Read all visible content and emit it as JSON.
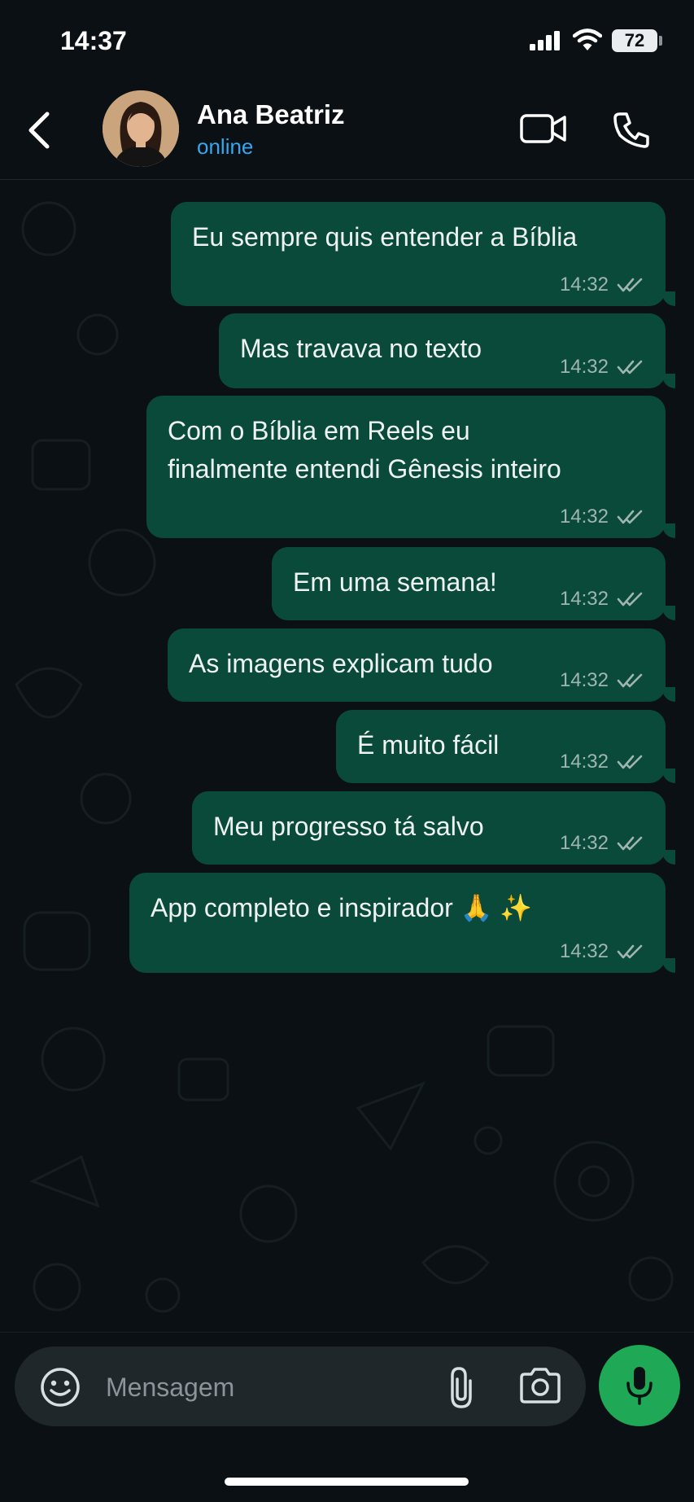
{
  "status_bar": {
    "time": "14:37",
    "battery": "72"
  },
  "header": {
    "contact_name": "Ana Beatriz",
    "contact_status": "online"
  },
  "messages": [
    {
      "text": "Eu sempre quis entender a Bíblia",
      "time": "14:32",
      "status": "read"
    },
    {
      "text": "Mas travava no texto",
      "time": "14:32",
      "status": "read"
    },
    {
      "text_lines": [
        "Com o Bíblia em Reels eu",
        "finalmente entendi Gênesis inteiro"
      ],
      "time": "14:32",
      "status": "read"
    },
    {
      "text": "Em uma semana!",
      "time": "14:32",
      "status": "read"
    },
    {
      "text": "As imagens explicam tudo",
      "time": "14:32",
      "status": "read"
    },
    {
      "text": "É muito fácil",
      "time": "14:32",
      "status": "read"
    },
    {
      "text": "Meu progresso tá salvo",
      "time": "14:32",
      "status": "read"
    },
    {
      "text": "App completo e inspirador 🙏 ✨",
      "time": "14:32",
      "status": "read"
    }
  ],
  "composer": {
    "placeholder": "Mensagem"
  },
  "colors": {
    "background": "#0b1014",
    "outgoing_bubble": "#0a4a3a",
    "online_status": "#35a7f0",
    "mic_button": "#1fa855"
  },
  "icons": [
    "back-arrow-icon",
    "video-call-icon",
    "phone-icon",
    "emoji-icon",
    "paperclip-icon",
    "camera-icon",
    "microphone-icon",
    "double-check-icon"
  ]
}
